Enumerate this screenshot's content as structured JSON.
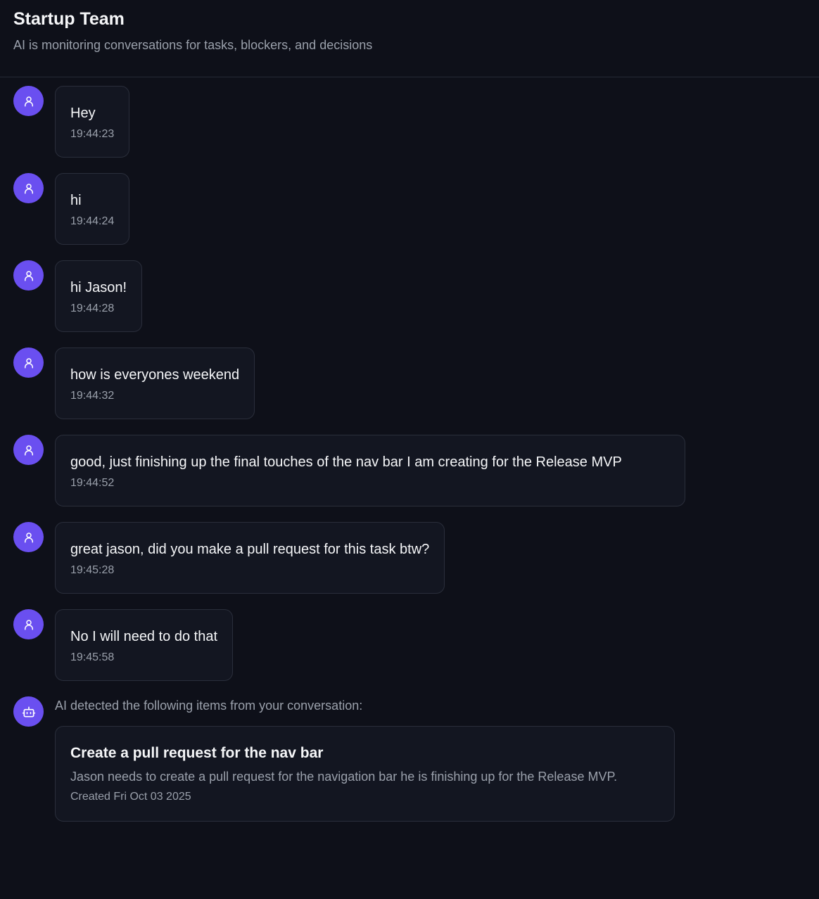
{
  "header": {
    "title": "Startup Team",
    "subtitle": "AI is monitoring conversations for tasks, blockers, and decisions"
  },
  "messages": [
    {
      "text": "Hey",
      "time": "19:44:23",
      "avatar_icon": "user-icon"
    },
    {
      "text": "hi",
      "time": "19:44:24",
      "avatar_icon": "user-icon"
    },
    {
      "text": "hi Jason!",
      "time": "19:44:28",
      "avatar_icon": "user-icon"
    },
    {
      "text": "how is everyones weekend",
      "time": "19:44:32",
      "avatar_icon": "user-icon"
    },
    {
      "text": "good, just finishing up the final touches of the nav bar I am creating for the Release MVP",
      "time": "19:44:52",
      "avatar_icon": "user-icon"
    },
    {
      "text": "great jason, did you make a pull request for this task btw?",
      "time": "19:45:28",
      "avatar_icon": "user-icon"
    },
    {
      "text": "No I will need to do that",
      "time": "19:45:58",
      "avatar_icon": "user-icon"
    }
  ],
  "ai": {
    "avatar_icon": "bot-icon",
    "intro": "AI detected the following items from your conversation:",
    "items": [
      {
        "title": "Create a pull request for the nav bar",
        "description": "Jason needs to create a pull request for the navigation bar he is finishing up for the Release MVP.",
        "created": "Created Fri Oct 03 2025"
      }
    ]
  },
  "colors": {
    "background": "#0e1019",
    "avatar": "#6a4ff0",
    "bubble": "#131621",
    "border": "#2a2e3b",
    "muted_text": "#9aa0ab"
  }
}
